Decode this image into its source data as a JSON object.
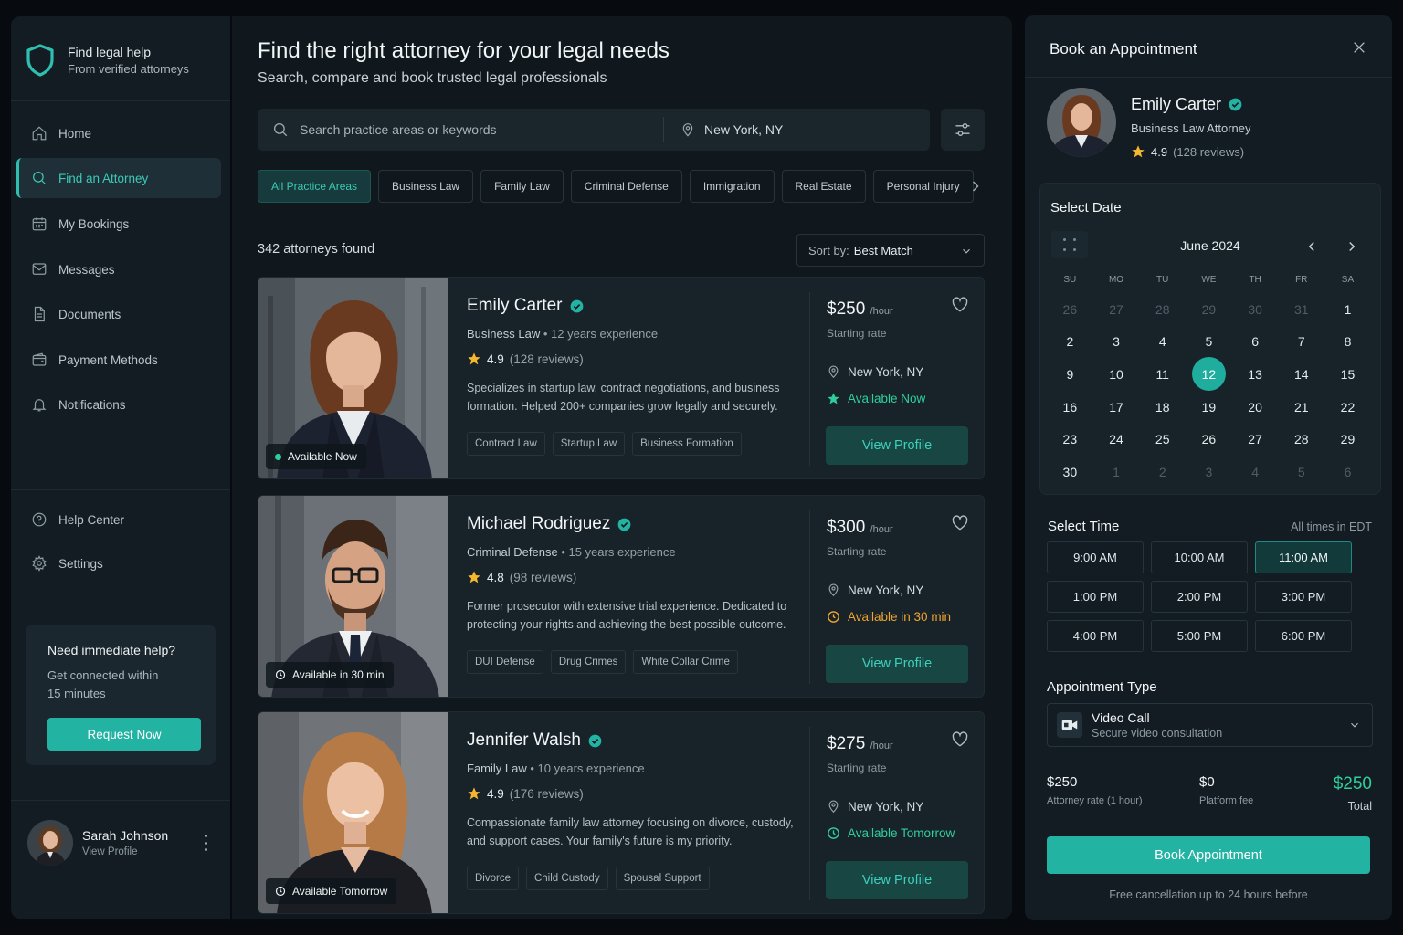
{
  "brand": {
    "title": "Find legal help",
    "subtitle": "From verified attorneys"
  },
  "sidebar": {
    "items": [
      {
        "label": "Home",
        "icon": "home-icon"
      },
      {
        "label": "Find an Attorney",
        "icon": "search-icon",
        "active": true
      },
      {
        "label": "My Bookings",
        "icon": "calendar-icon"
      },
      {
        "label": "Messages",
        "icon": "message-icon"
      },
      {
        "label": "Documents",
        "icon": "document-icon"
      },
      {
        "label": "Payment Methods",
        "icon": "wallet-icon"
      },
      {
        "label": "Notifications",
        "icon": "bell-icon"
      }
    ],
    "bottom_items": [
      {
        "label": "Help Center",
        "icon": "help-icon"
      },
      {
        "label": "Settings",
        "icon": "gear-icon"
      }
    ],
    "help_card": {
      "title": "Need immediate help?",
      "text_line1": "Get connected within",
      "text_line2": "15 minutes",
      "button": "Request Now"
    },
    "user": {
      "name": "Sarah Johnson",
      "link": "View Profile"
    }
  },
  "main": {
    "title": "Find the right attorney for your legal needs",
    "subtitle": "Search, compare and book trusted legal professionals",
    "search_placeholder": "Search practice areas or keywords",
    "location": "New York, NY",
    "chips": [
      "All Practice Areas",
      "Business Law",
      "Family Law",
      "Criminal Defense",
      "Immigration",
      "Real Estate",
      "Personal Injury"
    ],
    "results_count": "342 attorneys found",
    "sort_label": "Sort by:",
    "sort_value": "Best Match"
  },
  "attorneys": [
    {
      "name": "Emily Carter",
      "area": "Business Law",
      "experience": "12 years experience",
      "rating": "4.9",
      "reviews": "(128 reviews)",
      "desc_line1": "Specializes in startup law, contract negotiations, and business",
      "desc_line2": "formation. Helped 200+ companies grow legally and securely.",
      "tags": [
        "Contract Law",
        "Startup Law",
        "Business Formation"
      ],
      "price": "$250",
      "per": "/hour",
      "starting": "Starting rate",
      "location": "New York, NY",
      "availability": "Available Now",
      "photo_badge": "Available Now",
      "cta": "View Profile"
    },
    {
      "name": "Michael Rodriguez",
      "area": "Criminal Defense",
      "experience": "15 years experience",
      "rating": "4.8",
      "reviews": "(98 reviews)",
      "desc_line1": "Former prosecutor with extensive trial experience. Dedicated to",
      "desc_line2": "protecting your rights and achieving the best possible outcome.",
      "tags": [
        "DUI Defense",
        "Drug Crimes",
        "White Collar Crime"
      ],
      "price": "$300",
      "per": "/hour",
      "starting": "Starting rate",
      "location": "New York, NY",
      "availability": "Available in 30 min",
      "photo_badge": "Available in 30 min",
      "cta": "View Profile"
    },
    {
      "name": "Jennifer Walsh",
      "area": "Family Law",
      "experience": "10 years experience",
      "rating": "4.9",
      "reviews": "(176 reviews)",
      "desc_line1": "Compassionate family law attorney focusing on divorce, custody,",
      "desc_line2": "and support cases. Your family's future is my priority.",
      "tags": [
        "Divorce",
        "Child Custody",
        "Spousal Support"
      ],
      "price": "$275",
      "per": "/hour",
      "starting": "Starting rate",
      "location": "New York, NY",
      "availability": "Available Tomorrow",
      "photo_badge": "Available Tomorrow",
      "cta": "View Profile"
    }
  ],
  "booking": {
    "title": "Book an Appointment",
    "attorney_name": "Emily Carter",
    "attorney_role": "Business Law Attorney",
    "rating": "4.9",
    "reviews": "(128 reviews)",
    "select_date": "Select Date",
    "month": "June 2024",
    "weekdays": [
      "SU",
      "MO",
      "TU",
      "WE",
      "TH",
      "FR",
      "SA"
    ],
    "days": [
      "26",
      "27",
      "28",
      "29",
      "30",
      "31",
      "1",
      "2",
      "3",
      "4",
      "5",
      "6",
      "7",
      "8",
      "9",
      "10",
      "11",
      "12",
      "13",
      "14",
      "15",
      "16",
      "17",
      "18",
      "19",
      "20",
      "21",
      "22",
      "23",
      "24",
      "25",
      "26",
      "27",
      "28",
      "29",
      "30",
      "1",
      "2",
      "3",
      "4",
      "5",
      "6"
    ],
    "selected_day": "12",
    "select_time": "Select Time",
    "timezone": "All times in EDT",
    "times": [
      "9:00 AM",
      "10:00 AM",
      "11:00 AM",
      "1:00 PM",
      "2:00 PM",
      "3:00 PM",
      "4:00 PM",
      "5:00 PM",
      "6:00 PM"
    ],
    "selected_time": "11:00 AM",
    "appointment_type_label": "Appointment Type",
    "appointment_type": "Video Call",
    "appointment_desc": "Secure video consultation",
    "attorney_rate": "$250",
    "attorney_rate_label": "Attorney rate (1 hour)",
    "platform_fee": "$0",
    "platform_fee_label": "Platform fee",
    "total": "$250",
    "total_label": "Total",
    "button": "Book Appointment",
    "footnote": "Free cancellation up to 24 hours before"
  },
  "colors": {
    "accent": "#22b3a2",
    "available_now": "#2fcf9c",
    "available_soon": "#f0a531",
    "star": "#f5b730"
  }
}
